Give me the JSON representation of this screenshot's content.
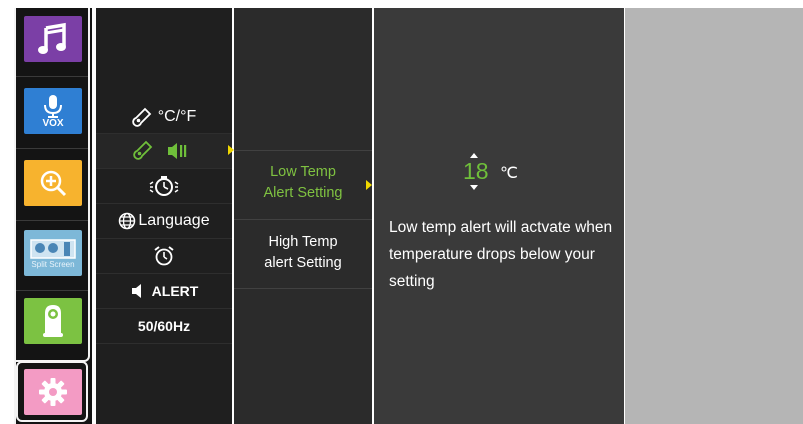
{
  "sidebar": {
    "items": [
      {
        "name": "music",
        "color": "#7b3fa6",
        "icon": "music-note-icon"
      },
      {
        "name": "vox",
        "color": "#2f7fd3",
        "icon": "microphone-icon",
        "label": "VOX"
      },
      {
        "name": "zoom",
        "color": "#f7b32e",
        "icon": "zoom-in-icon"
      },
      {
        "name": "split-screen",
        "color": "#7db8d8",
        "icon": "split-screen-icon",
        "label": "Split Screen"
      },
      {
        "name": "camera",
        "color": "#7cc242",
        "icon": "baby-camera-icon"
      },
      {
        "name": "settings",
        "color": "#f39bc4",
        "icon": "gear-icon",
        "selected": true
      }
    ]
  },
  "menu": {
    "items": [
      {
        "label": "°C/°F",
        "icon": "thermometer-icon"
      },
      {
        "label": "",
        "icon": "temperature-alert-icon",
        "selected": true
      },
      {
        "label": "",
        "icon": "timer-icon"
      },
      {
        "label": "Language",
        "icon": "globe-icon"
      },
      {
        "label": "",
        "icon": "alarm-clock-icon"
      },
      {
        "label": "ALERT",
        "icon": "speaker-icon"
      },
      {
        "label": "50/60Hz",
        "icon": ""
      }
    ]
  },
  "submenu": {
    "low": {
      "line1": "Low Temp",
      "line2": "Alert Setting",
      "selected": true
    },
    "high": {
      "line1": "High Temp",
      "line2": "alert Setting"
    }
  },
  "detail": {
    "value": "18",
    "unit": "℃",
    "description": "Low temp alert will actvate when temperature drops below your setting"
  },
  "colors": {
    "accent_green": "#6fbf3a",
    "arrow_yellow": "#f0d800"
  }
}
